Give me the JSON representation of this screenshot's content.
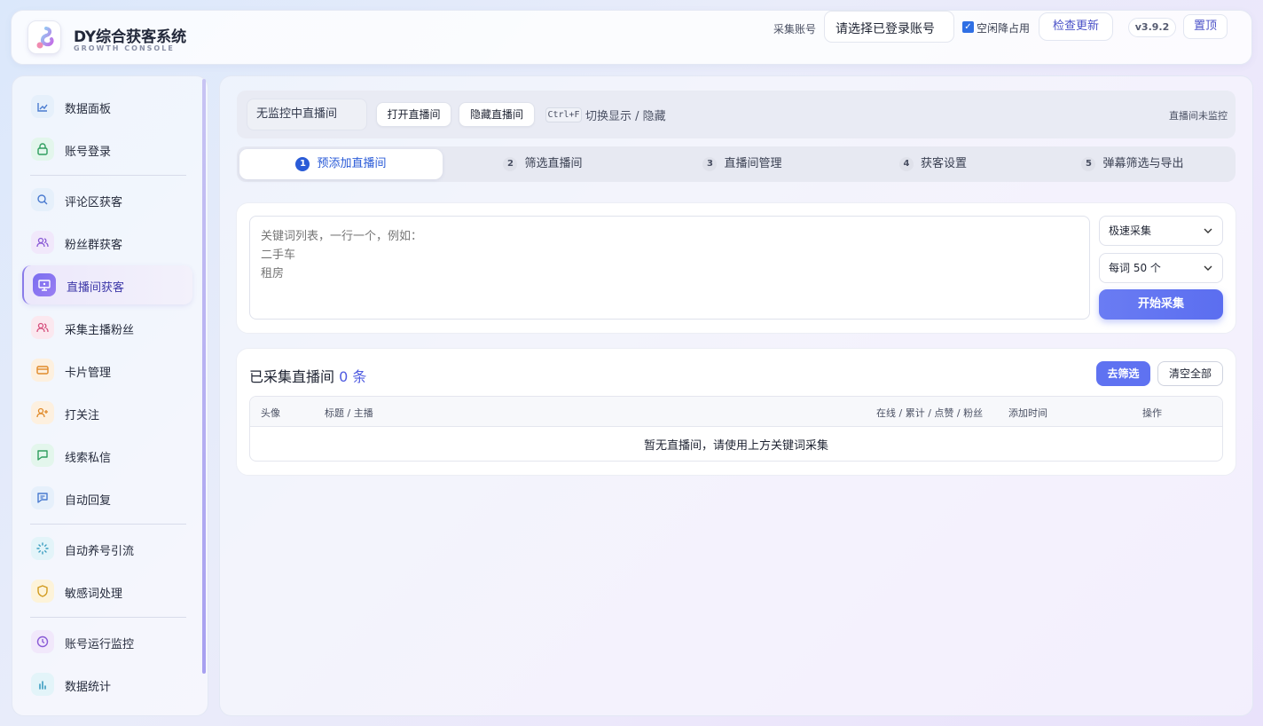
{
  "header": {
    "app_title": "DY综合获客系统",
    "app_subtitle": "GROWTH CONSOLE",
    "account_label": "采集账号",
    "account_select": "请选择已登录账号",
    "idle_checked": true,
    "idle_label": "空闲降占用",
    "check_update": "检查更新",
    "version": "v3.9.2",
    "pin_top": "置顶"
  },
  "sidebar": {
    "items": [
      {
        "label": "数据面板",
        "icon": "chart-line-icon"
      },
      {
        "label": "账号登录",
        "icon": "lock-icon"
      },
      {
        "label": "评论区获客",
        "icon": "search-icon"
      },
      {
        "label": "粉丝群获客",
        "icon": "users-icon"
      },
      {
        "label": "直播间获客",
        "icon": "monitor-icon",
        "active": true
      },
      {
        "label": "采集主播粉丝",
        "icon": "users-icon"
      },
      {
        "label": "卡片管理",
        "icon": "card-icon"
      },
      {
        "label": "打关注",
        "icon": "user-plus-icon"
      },
      {
        "label": "线索私信",
        "icon": "message-icon"
      },
      {
        "label": "自动回复",
        "icon": "reply-icon"
      },
      {
        "label": "自动养号引流",
        "icon": "loader-icon"
      },
      {
        "label": "敏感词处理",
        "icon": "shield-icon"
      },
      {
        "label": "账号运行监控",
        "icon": "clock-icon"
      },
      {
        "label": "数据统计",
        "icon": "bar-chart-icon"
      }
    ]
  },
  "monitor": {
    "status": "无监控中直播间",
    "open_btn": "打开直播间",
    "hide_btn": "隐藏直播间",
    "shortcut_key": "Ctrl+F",
    "shortcut_text": "切换显示 / 隐藏",
    "right_status": "直播间未监控"
  },
  "steps": [
    {
      "num": "1",
      "label": "预添加直播间"
    },
    {
      "num": "2",
      "label": "筛选直播间"
    },
    {
      "num": "3",
      "label": "直播间管理"
    },
    {
      "num": "4",
      "label": "获客设置"
    },
    {
      "num": "5",
      "label": "弹幕筛选与导出"
    }
  ],
  "collect": {
    "keywords_placeholder": "关键词列表，一行一个，例如：\n二手车\n租房",
    "mode": "极速采集",
    "per_word": "每词 50 个",
    "start": "开始采集"
  },
  "collected": {
    "title": "已采集直播间",
    "count": "0 条",
    "filter_btn": "去筛选",
    "clear_btn": "清空全部",
    "columns": [
      "头像",
      "标题 / 主播",
      "在线 / 累计 / 点赞 / 粉丝",
      "添加时间",
      "操作"
    ],
    "empty": "暂无直播间，请使用上方关键词采集"
  }
}
